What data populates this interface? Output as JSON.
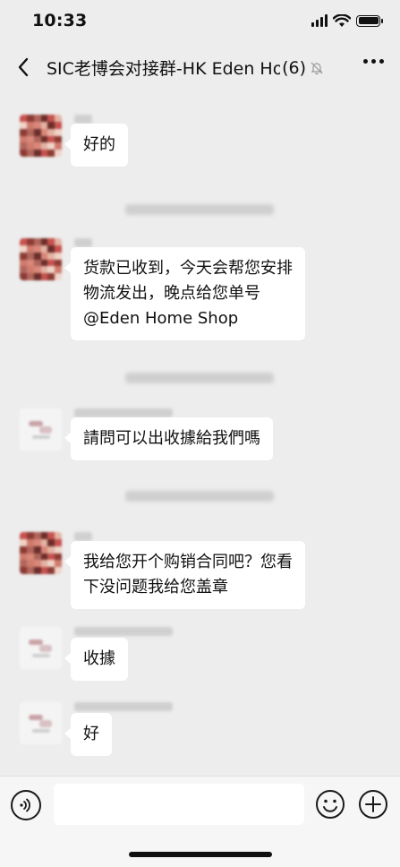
{
  "status_bar": {
    "time": "10:33"
  },
  "header": {
    "title": "SIC老博会对接群-HK Eden Home Shop",
    "member_count": "(6)"
  },
  "messages": [
    {
      "text_lines": [
        "好的"
      ]
    },
    {
      "text_lines": [
        "货款已收到，今天会帮您安排",
        "物流发出，晚点给您单号",
        "@Eden Home Shop"
      ]
    },
    {
      "text_lines": [
        "請問可以出收據給我們嗎"
      ]
    },
    {
      "text_lines": [
        "我给您开个购销合同吧？您看",
        "下没问题我给您盖章"
      ]
    },
    {
      "text_lines": [
        "收據"
      ]
    },
    {
      "text_lines": [
        "好"
      ]
    }
  ],
  "input": {
    "value": ""
  },
  "icons": {
    "back": "chevron-left-icon",
    "mute": "bell-off-icon",
    "more": "more-dots-icon",
    "voice": "voice-icon",
    "emoji": "emoji-icon",
    "plus": "plus-circle-icon"
  },
  "colors": {
    "background": "#ededed",
    "bubble": "#ffffff",
    "text": "#111111"
  }
}
